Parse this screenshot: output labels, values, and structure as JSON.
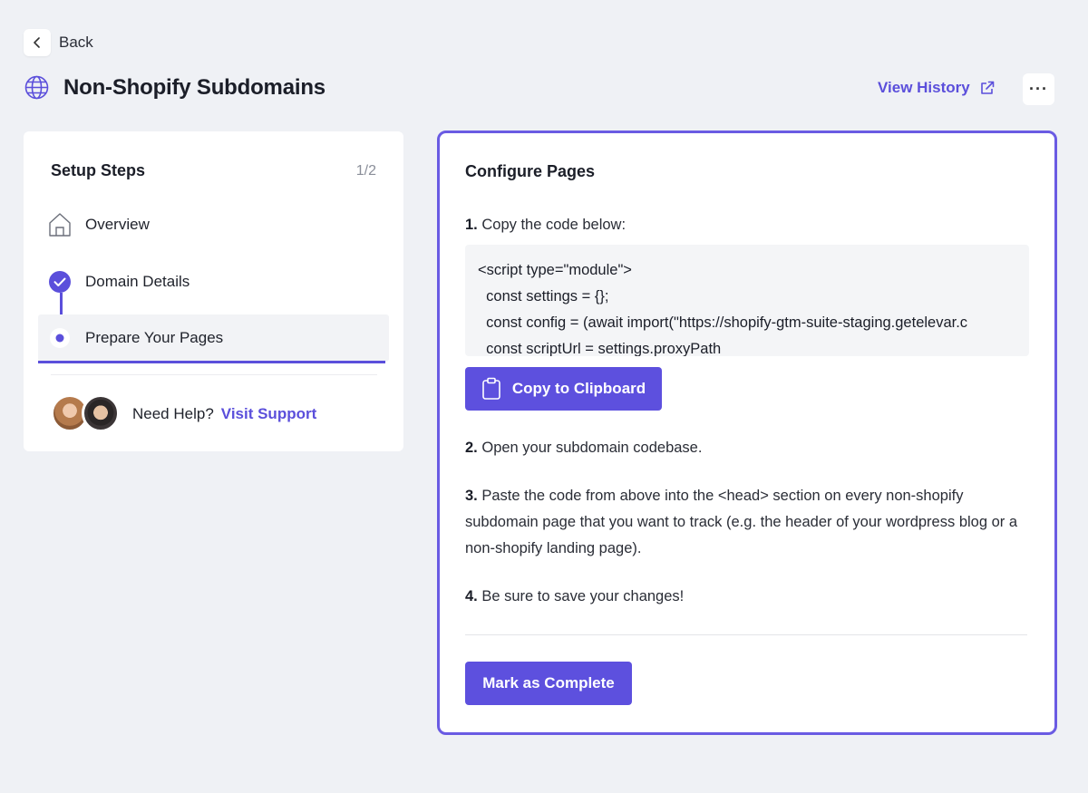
{
  "nav": {
    "back_label": "Back"
  },
  "header": {
    "title": "Non-Shopify Subdomains",
    "view_history": "View History",
    "more_label": "···"
  },
  "steps": {
    "heading": "Setup Steps",
    "count": "1/2",
    "items": [
      {
        "label": "Overview",
        "state": "default",
        "icon": "home-icon"
      },
      {
        "label": "Domain Details",
        "state": "completed",
        "icon": "check-circle-icon"
      },
      {
        "label": "Prepare Your Pages",
        "state": "active",
        "icon": "dot-icon"
      }
    ],
    "help_text": "Need Help?",
    "help_link": "Visit Support"
  },
  "main": {
    "title": "Configure Pages",
    "step1_num": "1.",
    "step1_text": "Copy the code below:",
    "code_lines": [
      "<script type=\"module\">",
      "  const settings = {};",
      "  const config = (await import(\"https://shopify-gtm-suite-staging.getelevar.c",
      "  const scriptUrl = settings.proxyPath"
    ],
    "copy_label": "Copy to Clipboard",
    "step2_num": "2.",
    "step2_text": "Open your subdomain codebase.",
    "step3_num": "3.",
    "step3_text": "Paste the code from above into the <head> section on every non-shopify subdomain page that you want to track (e.g. the header of your wordpress blog or a non-shopify landing page).",
    "step4_num": "4.",
    "step4_text": "Be sure to save your changes!",
    "complete_label": "Mark as Complete"
  },
  "colors": {
    "accent": "#5d50de",
    "background": "#eff1f5",
    "card": "#ffffff"
  }
}
